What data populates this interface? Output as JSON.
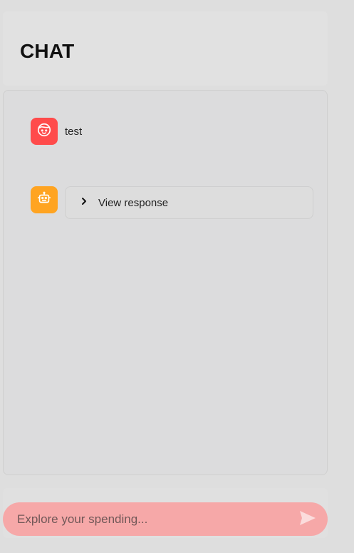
{
  "header": {
    "title": "CHAT"
  },
  "messages": [
    {
      "role": "user",
      "avatar_icon": "face-icon",
      "avatar_color": "#ff4b4b",
      "text": "test"
    },
    {
      "role": "assistant",
      "avatar_icon": "robot-icon",
      "avatar_color": "#ffa421",
      "expander_label": "View response",
      "expander_icon": "chevron-right-icon"
    }
  ],
  "chat_input": {
    "placeholder": "Explore your spending...",
    "value": "",
    "background": "#f6a8a8",
    "send_icon": "send-icon"
  }
}
